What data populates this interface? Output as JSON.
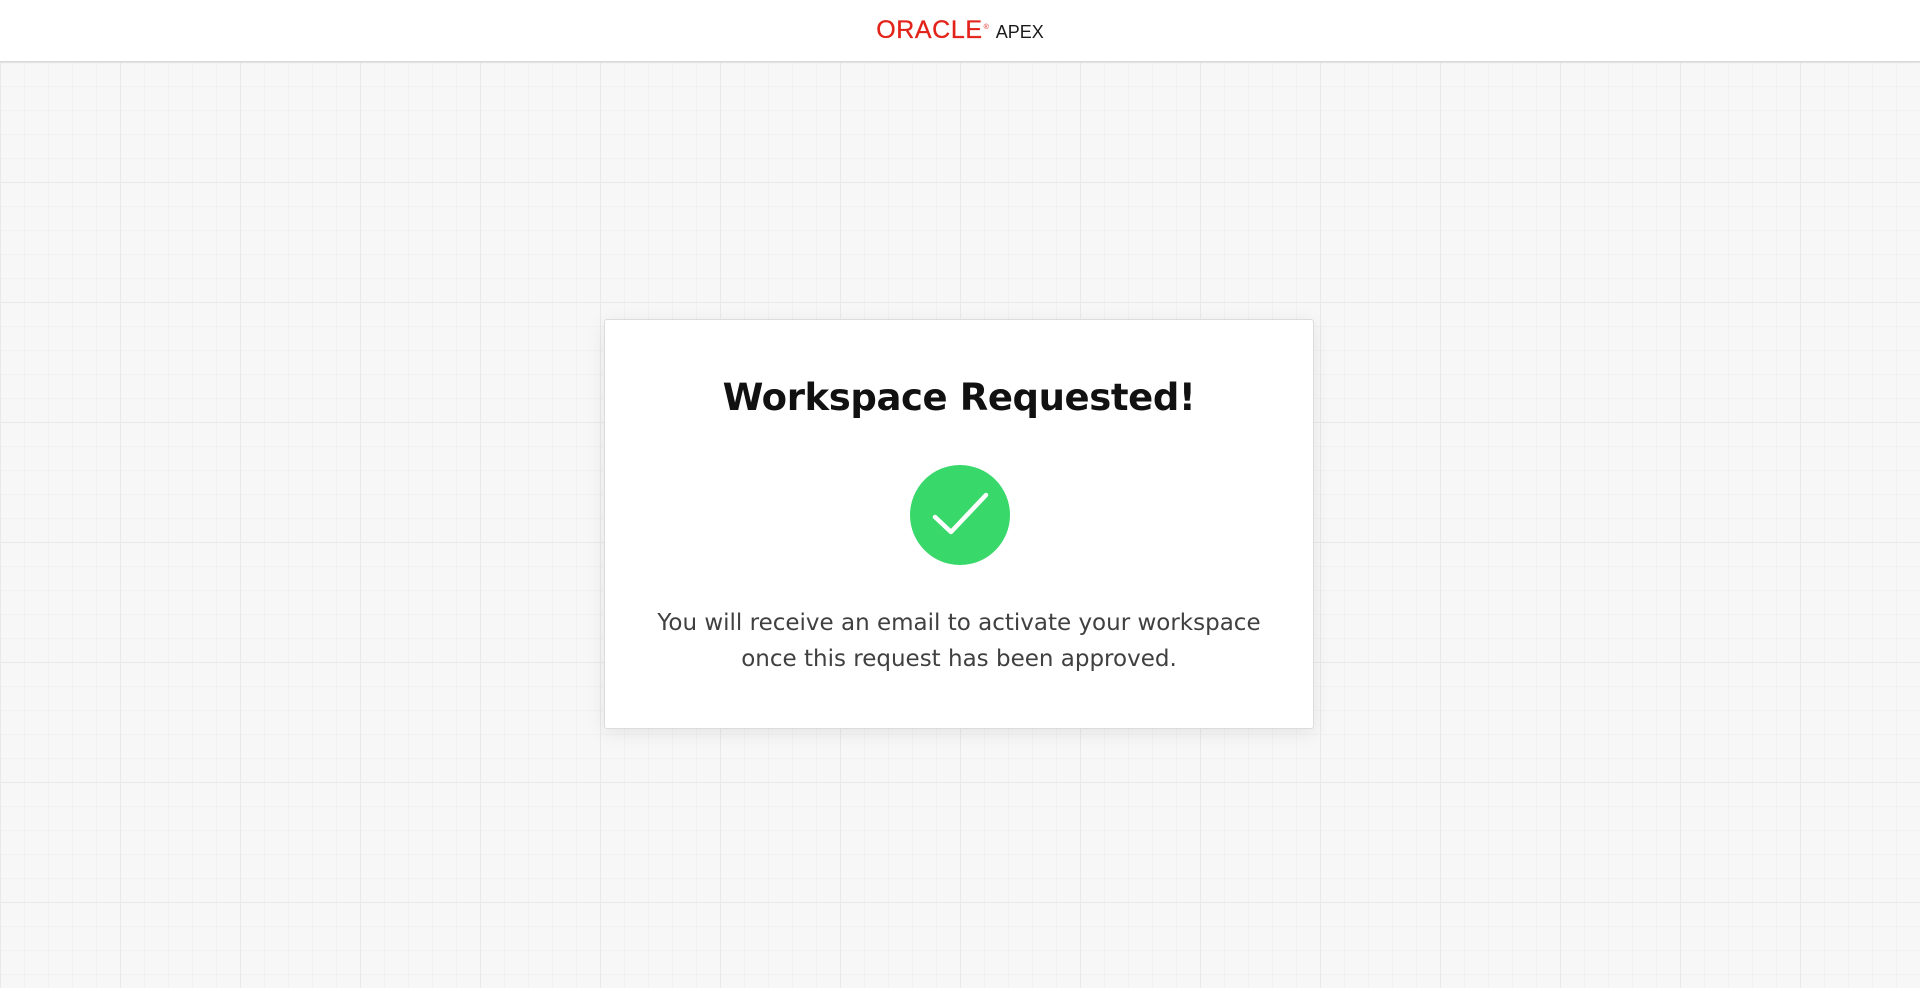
{
  "header": {
    "logo_brand": "ORACLE",
    "logo_reg_mark": "®",
    "logo_product": "APEX",
    "brand_color": "#e2231a"
  },
  "card": {
    "title": "Workspace Requested!",
    "status_icon": "check-circle-icon",
    "status_color": "#39d86a",
    "message_line1": "You will receive an email to activate your workspace",
    "message_line2": "once this request has been approved."
  }
}
